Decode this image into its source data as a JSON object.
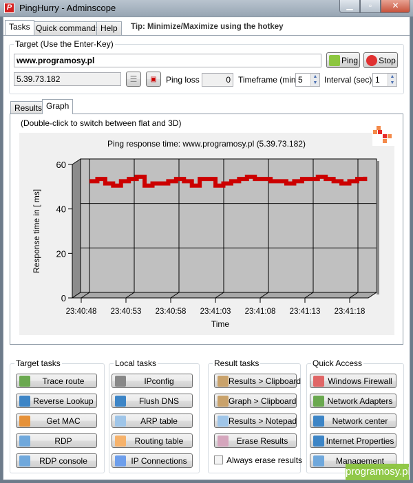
{
  "window": {
    "title": "PingHurry - Adminscope",
    "icon": "p-logo-icon",
    "controls": [
      "minimize",
      "maximize",
      "close"
    ]
  },
  "tabs": [
    {
      "label": "Tasks",
      "active": true
    },
    {
      "label": "Quick commands"
    },
    {
      "label": "Help"
    }
  ],
  "tip": "Tip: Minimize/Maximize using the hotkey",
  "target": {
    "group_label": "Target (Use the Enter-Key)",
    "host_value": "www.programosy.pl",
    "ip_value": "5.39.73.182",
    "ping_label": "Ping",
    "stop_label": "Stop",
    "ping_loss_label": "Ping loss",
    "ping_loss_value": "0",
    "timeframe_label": "Timeframe (min)",
    "timeframe_value": "5",
    "interval_label": "Interval (sec)",
    "interval_value": "1"
  },
  "subtabs": [
    {
      "label": "Results"
    },
    {
      "label": "Graph",
      "active": true
    }
  ],
  "graph_hint": "(Double-click to switch between flat and 3D)",
  "chart_data": {
    "type": "line",
    "title": "Ping response time: www.programosy.pl (5.39.73.182)",
    "xlabel": "Time",
    "ylabel": "Response time in [ ms]",
    "ylim": [
      0,
      60
    ],
    "yticks": [
      0,
      20,
      40,
      60
    ],
    "xticks": [
      "23:40:48",
      "23:40:53",
      "23:40:58",
      "23:41:03",
      "23:41:08",
      "23:41:13",
      "23:41:18"
    ],
    "x_start": "23:40:48",
    "x_step_seconds": 1,
    "values": [
      50,
      51,
      49,
      48,
      50,
      51,
      52,
      48,
      49,
      49,
      50,
      51,
      50,
      48,
      51,
      51,
      48,
      49,
      50,
      51,
      52,
      51,
      51,
      50,
      50,
      49,
      50,
      51,
      51,
      52,
      51,
      50,
      49,
      50,
      51,
      52
    ],
    "grid": true,
    "style": "3d",
    "line_color": "#cc0000",
    "plot_bg": "#c0c0c0"
  },
  "groups": [
    {
      "label": "Target tasks",
      "buttons": [
        {
          "label": "Trace route",
          "icon": "trace-route-icon",
          "color": "#6aa84f"
        },
        {
          "label": "Reverse Lookup",
          "icon": "dns-globe-icon",
          "color": "#3d85c6"
        },
        {
          "label": "Get MAC",
          "icon": "burger-icon",
          "color": "#e69138"
        },
        {
          "label": "RDP",
          "icon": "monitor-icon",
          "color": "#6fa8dc"
        },
        {
          "label": "RDP console",
          "icon": "monitor-icon",
          "color": "#6fa8dc"
        }
      ]
    },
    {
      "label": "Local tasks",
      "buttons": [
        {
          "label": "IPconfig",
          "icon": "terminal-icon",
          "color": "#888888"
        },
        {
          "label": "Flush DNS",
          "icon": "dns-globe-icon",
          "color": "#3d85c6"
        },
        {
          "label": "ARP table",
          "icon": "table-icon",
          "color": "#9fc5e8"
        },
        {
          "label": "Routing table",
          "icon": "routing-table-icon",
          "color": "#f6b26b"
        },
        {
          "label": "IP Connections",
          "icon": "connection-icon",
          "color": "#6d9eeb"
        }
      ]
    },
    {
      "label": "Result tasks",
      "buttons": [
        {
          "label": "Results > Clipboard",
          "icon": "clipboard-icon",
          "color": "#c9a26b"
        },
        {
          "label": "Graph > Clipboard",
          "icon": "clipboard-icon",
          "color": "#c9a26b"
        },
        {
          "label": "Results > Notepad",
          "icon": "notepad-icon",
          "color": "#9fc5e8"
        },
        {
          "label": "Erase Results",
          "icon": "eraser-icon",
          "color": "#d5a6bd"
        }
      ],
      "checkbox": {
        "label": "Always erase results",
        "checked": false
      }
    },
    {
      "label": "Quick Access",
      "buttons": [
        {
          "label": "Windows Firewall",
          "icon": "firewall-icon",
          "color": "#e06666"
        },
        {
          "label": "Network Adapters",
          "icon": "network-adapter-icon",
          "color": "#6aa84f"
        },
        {
          "label": "Network center",
          "icon": "network-globe-icon",
          "color": "#3d85c6"
        },
        {
          "label": "Internet Properties",
          "icon": "internet-explorer-icon",
          "color": "#3d85c6"
        },
        {
          "label": "Management",
          "icon": "management-icon",
          "color": "#6fa8dc"
        }
      ]
    }
  ],
  "watermark": "programosy.pl"
}
